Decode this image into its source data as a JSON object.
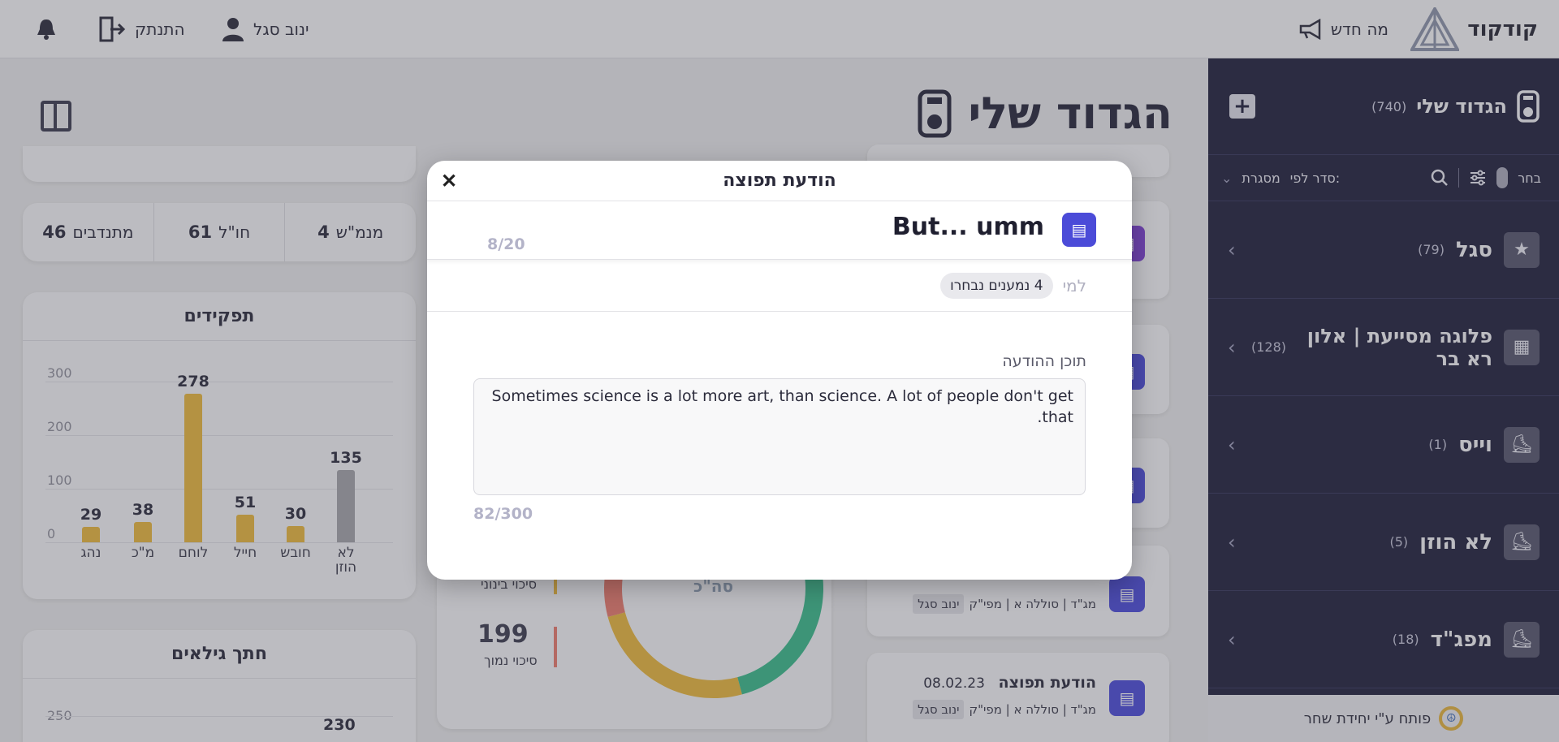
{
  "topbar": {
    "logo_text": "קודקוד",
    "whats_new": "מה חדש",
    "user_name": "ינוב סגל",
    "logout": "התנתק"
  },
  "sidebar": {
    "title": "הגדוד שלי",
    "count": "(740)",
    "filter": {
      "select_label": "בחר",
      "sort_label": "סדר לפי:",
      "sort_value": "מסגרת"
    },
    "items": [
      {
        "name": "סגל",
        "count": "(79)",
        "icon": "star-icon"
      },
      {
        "name": "פלוגה מסייעת | אלון רא בר",
        "count": "(128)",
        "icon": "building-icon"
      },
      {
        "name": "וייס",
        "count": "(1)",
        "icon": "boot-icon"
      },
      {
        "name": "לא הוזן",
        "count": "(5)",
        "icon": "boot-icon"
      },
      {
        "name": "מפג\"ד",
        "count": "(18)",
        "icon": "boot-icon"
      }
    ],
    "footer": "פותח ע\"י יחידת שחר"
  },
  "page": {
    "title": "הגדוד שלי"
  },
  "stats": [
    {
      "value": "46",
      "label": "מתנדבים"
    },
    {
      "value": "61",
      "label": "חו\"ל"
    },
    {
      "value": "4",
      "label": "מנמ\"ש"
    }
  ],
  "roles_card": {
    "title": "תפקידים"
  },
  "ages_card": {
    "title": "חתך גילאים",
    "first_tick": "250",
    "first_value": "230"
  },
  "chart_data": {
    "type": "bar",
    "title": "תפקידים",
    "categories": [
      "נהג",
      "מ\"כ",
      "לוחם",
      "חייל",
      "חובש",
      "לא הוזן"
    ],
    "values": [
      29,
      38,
      278,
      51,
      30,
      135
    ],
    "yticks": [
      "0",
      "100",
      "200",
      "300"
    ],
    "ylim": [
      0,
      300
    ],
    "colors": [
      "#e8b63c",
      "#e8b63c",
      "#e8b63c",
      "#e8b63c",
      "#e8b63c",
      "#a3a3a8"
    ],
    "xlabel": "",
    "ylabel": ""
  },
  "risk": {
    "medium_label": "סיכוי בינוני",
    "low_value": "199",
    "low_label": "סיכוי נמוך",
    "donut_label": "סה\"כ"
  },
  "messages": [
    {
      "title": "",
      "date": "",
      "author": "ינוב סגל",
      "detail": "מג\"ד | סוללה א | מפי\"ק"
    },
    {
      "title": "הודעת תפוצה",
      "date": "08.02.23",
      "author": "ינוב סגל",
      "detail": "מג\"ד | סוללה א | מפי\"ק"
    }
  ],
  "modal": {
    "title": "הודעת תפוצה",
    "subject": "But... umm",
    "subject_count": "8/20",
    "recipients_label": "למי",
    "recipients_chip": "4 נמענים נבחרו",
    "content_label": "תוכן ההודעה",
    "content": "Sometimes science is a lot more art, than science. A lot of people don't get that.",
    "content_count": "82/300"
  }
}
